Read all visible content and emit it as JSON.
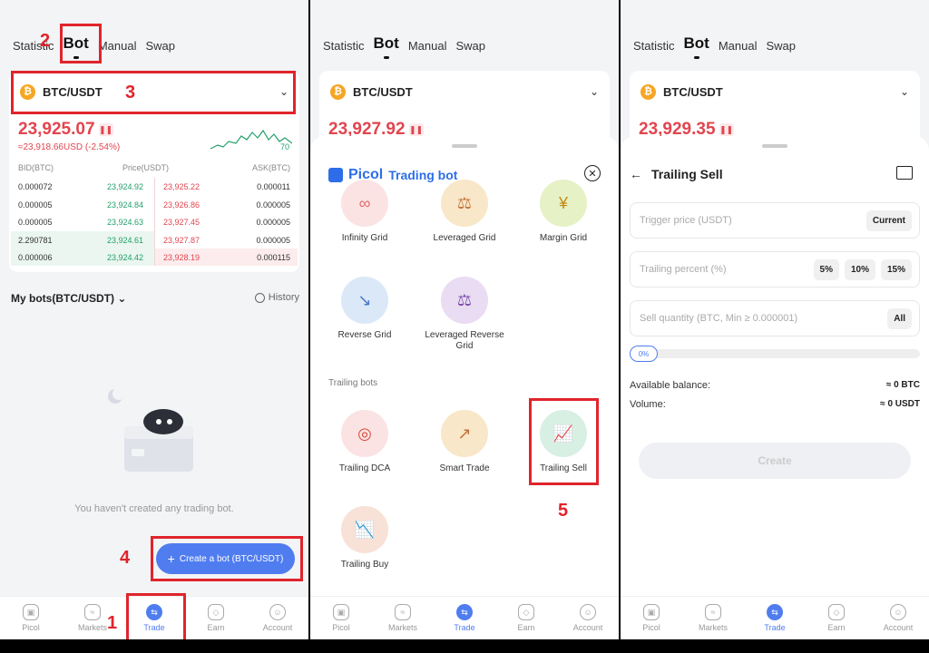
{
  "tabs": [
    "Statistic",
    "Bot",
    "Manual",
    "Swap"
  ],
  "pair": "BTC/USDT",
  "coin_glyph": "₿",
  "panel1": {
    "price": "23,925.07",
    "price_sub": "≈23,918.66USD (-2.54%)",
    "spark_value": "70",
    "orderbook_headers": {
      "bid": "BID(BTC)",
      "price": "Price(USDT)",
      "ask": "ASK(BTC)"
    },
    "orderbook_rows": [
      {
        "bid": "0.000072",
        "bid_price": "23,924.92",
        "ask_price": "23,925.22",
        "ask": "0.000011"
      },
      {
        "bid": "0.000005",
        "bid_price": "23,924.84",
        "ask_price": "23,926.86",
        "ask": "0.000005"
      },
      {
        "bid": "0.000005",
        "bid_price": "23,924.63",
        "ask_price": "23,927.45",
        "ask": "0.000005"
      },
      {
        "bid": "2.290781",
        "bid_price": "23,924.61",
        "ask_price": "23,927.87",
        "ask": "0.000005"
      },
      {
        "bid": "0.000006",
        "bid_price": "23,924.42",
        "ask_price": "23,928.19",
        "ask": "0.000115"
      }
    ],
    "my_bots_label": "My bots(BTC/USDT)",
    "history_label": "History",
    "empty_text": "You haven't created any trading bot.",
    "create_label": "Create a bot (BTC/USDT)"
  },
  "panel2": {
    "price": "23,927.92",
    "brand": "Picol",
    "sheet_title": "Trading bot",
    "grid_bots": [
      "Infinity Grid",
      "Leveraged Grid",
      "Margin Grid",
      "Reverse Grid",
      "Leveraged Reverse Grid"
    ],
    "trailing_section": "Trailing bots",
    "trailing_bots": [
      "Trailing DCA",
      "Smart Trade",
      "Trailing Sell",
      "Trailing Buy"
    ]
  },
  "panel3": {
    "price": "23,929.35",
    "title": "Trailing Sell",
    "trigger_placeholder": "Trigger price (USDT)",
    "current_label": "Current",
    "trailing_placeholder": "Trailing percent (%)",
    "percent_chips": [
      "5%",
      "10%",
      "15%"
    ],
    "quantity_placeholder": "Sell quantity (BTC, Min ≥ 0.000001)",
    "all_label": "All",
    "slider_value": "0%",
    "balance_label": "Available balance:",
    "balance_value": "≈ 0 BTC",
    "volume_label": "Volume:",
    "volume_value": "≈ 0 USDT",
    "create_label": "Create"
  },
  "nav": [
    "Picol",
    "Markets",
    "Trade",
    "Earn",
    "Account"
  ],
  "annotations": [
    "1",
    "2",
    "3",
    "4",
    "5"
  ],
  "colors": {
    "accent": "#4f7df0",
    "down": "#e1454f",
    "up": "#22a06b",
    "annotation": "#e0242b"
  }
}
